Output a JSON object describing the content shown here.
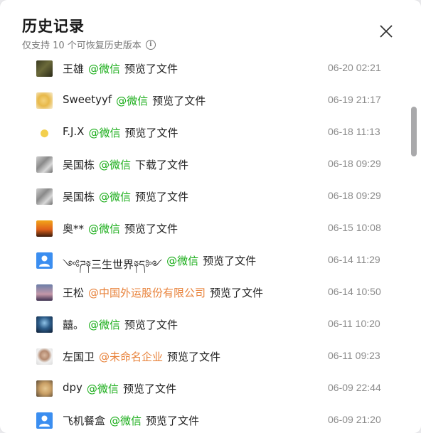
{
  "header": {
    "title": "历史记录",
    "subtitle": "仅支持 10 个可恢复历史版本"
  },
  "colors": {
    "wechat": "#1aad19",
    "company": "#e8823a",
    "time": "#8a8a8a",
    "default_avatar": "#3b8ef0"
  },
  "history": [
    {
      "name": "王雄",
      "org": "@微信",
      "action": "预览了文件",
      "time": "06-20 02:21",
      "avatar": "photo-dark"
    },
    {
      "name": "Sweetyyf",
      "org": "@微信",
      "action": "预览了文件",
      "time": "06-19 21:17",
      "avatar": "photo-yellow"
    },
    {
      "name": "F.J.X",
      "org": "@微信",
      "action": "预览了文件",
      "time": "06-18 11:13",
      "avatar": "photo-cartoon"
    },
    {
      "name": "吴国栋",
      "org": "@微信",
      "action": "下载了文件",
      "time": "06-18 09:29",
      "avatar": "photo-grey"
    },
    {
      "name": "吴国栋",
      "org": "@微信",
      "action": "预览了文件",
      "time": "06-18 09:29",
      "avatar": "photo-grey"
    },
    {
      "name": "奥**",
      "org": "@微信",
      "action": "预览了文件",
      "time": "06-15 10:08",
      "avatar": "photo-sunset"
    },
    {
      "name": "༺ཌ༈三生世界༈ད༻",
      "org": "@微信",
      "action": "预览了文件",
      "time": "06-14 11:29",
      "avatar": "default"
    },
    {
      "name": "王松",
      "org": "@中国外运股份有限公司",
      "action": "预览了文件",
      "time": "06-14 10:50",
      "avatar": "photo-dusk",
      "org_type": "company"
    },
    {
      "name": "囍。",
      "org": "@微信",
      "action": "预览了文件",
      "time": "06-11 10:20",
      "avatar": "photo-night"
    },
    {
      "name": "左国卫",
      "org": "@未命名企业",
      "action": "预览了文件",
      "time": "06-11 09:23",
      "avatar": "photo-portrait",
      "org_type": "company"
    },
    {
      "name": "dpy",
      "org": "@微信",
      "action": "预览了文件",
      "time": "06-09 22:44",
      "avatar": "photo-dog"
    },
    {
      "name": "飞机餐盒",
      "org": "@微信",
      "action": "预览了文件",
      "time": "06-09 21:20",
      "avatar": "default"
    }
  ]
}
